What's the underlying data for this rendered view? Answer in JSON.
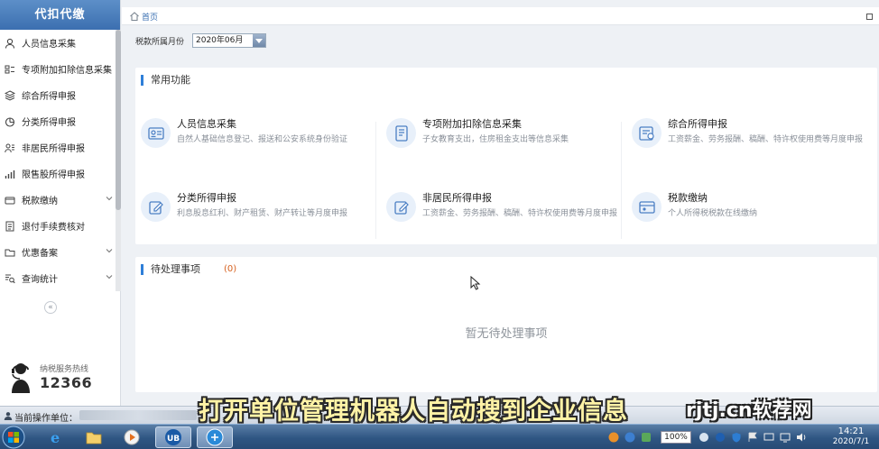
{
  "sidebar": {
    "brand": "代扣代缴",
    "items": [
      {
        "label": "人员信息采集",
        "icon": "person-icon",
        "chevron": false
      },
      {
        "label": "专项附加扣除信息采集",
        "icon": "deduction-icon",
        "chevron": false
      },
      {
        "label": "综合所得申报",
        "icon": "layers-icon",
        "chevron": false
      },
      {
        "label": "分类所得申报",
        "icon": "pie-chart-icon",
        "chevron": false
      },
      {
        "label": "非居民所得申报",
        "icon": "user-group-icon",
        "chevron": false
      },
      {
        "label": "限售股所得申报",
        "icon": "bar-chart-icon",
        "chevron": false
      },
      {
        "label": "税款缴纳",
        "icon": "wallet-icon",
        "chevron": true
      },
      {
        "label": "退付手续费核对",
        "icon": "document-icon",
        "chevron": false
      },
      {
        "label": "优惠备案",
        "icon": "folder-icon",
        "chevron": true
      },
      {
        "label": "查询统计",
        "icon": "search-list-icon",
        "chevron": true
      }
    ],
    "collapse_glyph": "«",
    "hotline_label": "纳税服务热线",
    "hotline_number": "12366"
  },
  "topbar": {
    "home": "首页"
  },
  "filter": {
    "label": "税款所属月份",
    "month": "2020年06月"
  },
  "common": {
    "title": "常用功能",
    "functions": [
      {
        "name": "人员信息采集",
        "desc": "自然人基础信息登记、报送和公安系统身份验证",
        "icon": "id-card-icon"
      },
      {
        "name": "专项附加扣除信息采集",
        "desc": "子女教育支出，住房租金支出等信息采集",
        "icon": "deduction-doc-icon"
      },
      {
        "name": "综合所得申报",
        "desc": "工资薪金、劳务报酬、稿酬、特许权使用费等月度申报",
        "icon": "tax-form-icon"
      },
      {
        "name": "分类所得申报",
        "desc": "利息股息红利、财产租赁、财产转让等月度申报",
        "icon": "edit-icon"
      },
      {
        "name": "非居民所得申报",
        "desc": "工资薪金、劳务报酬、稿酬、特许权使用费等月度申报",
        "icon": "edit-icon"
      },
      {
        "name": "税款缴纳",
        "desc": "个人所得税税款在线缴纳",
        "icon": "payment-icon"
      }
    ]
  },
  "pending": {
    "title": "待处理事项",
    "count": "(0)",
    "empty": "暂无待处理事项"
  },
  "status": {
    "label": "当前操作单位："
  },
  "overlay": {
    "caption": "打开单位管理机器人自动搜到企业信息",
    "watermark": "rjtj.cn软荐网"
  },
  "taskbar": {
    "zoom": "100%",
    "time": "14:21",
    "date": "2020/7/1"
  },
  "colors": {
    "accent": "#2f7fd8",
    "brand_bar": "#4a7dbd",
    "pending_count": "#d6601e",
    "caption": "#fff3a6"
  }
}
